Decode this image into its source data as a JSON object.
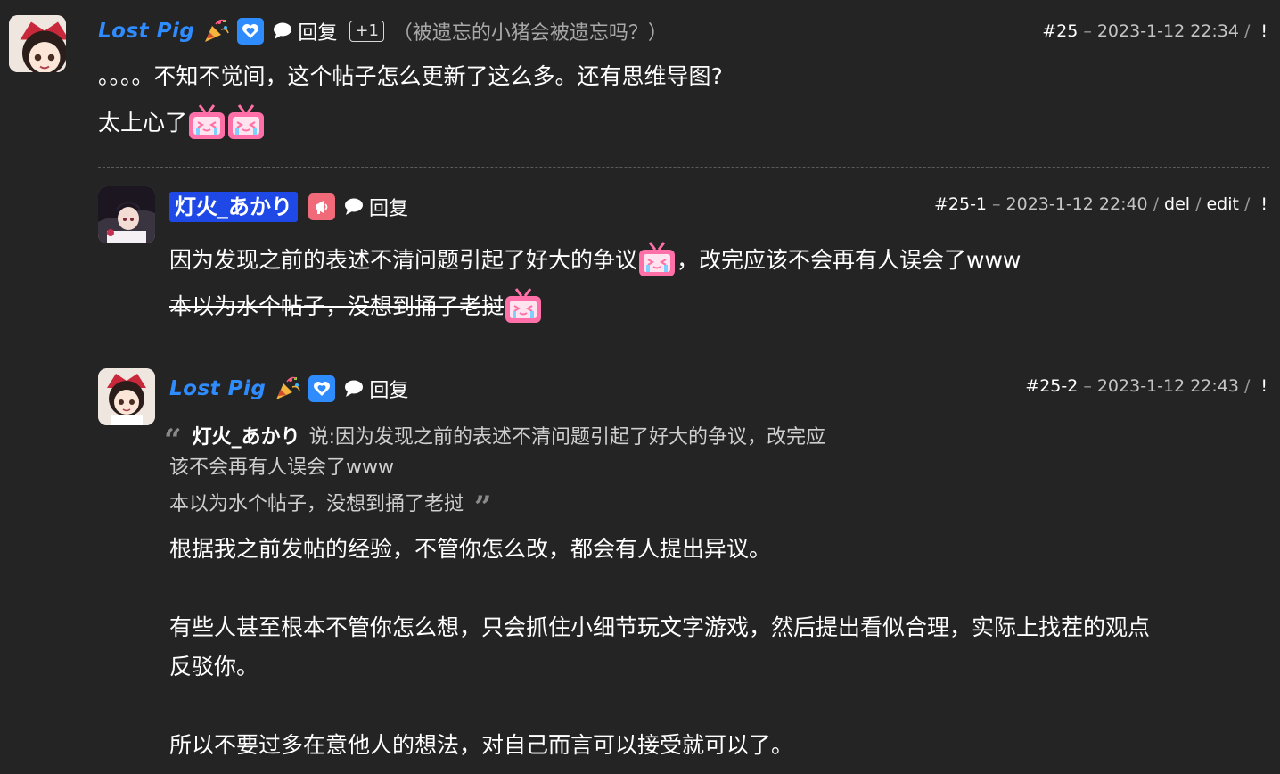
{
  "posts": {
    "p25": {
      "author": "Lost Pig",
      "reply_label": "回复",
      "plus": "+1",
      "thread_title": "（被遗忘的小猪会被遗忘吗？）",
      "num": "#25",
      "dash": "–",
      "date": "2023-1-12 22:34",
      "slash": "/",
      "bang": "!",
      "lines": [
        "。。。。不知不觉间，这个帖子怎么更新了这么多。还有思维导图?",
        "太上心了"
      ]
    },
    "p25_1": {
      "author": "灯火_あかり",
      "reply_label": "回复",
      "num": "#25-1",
      "dash": "–",
      "date": "2023-1-12 22:40",
      "slash": "/",
      "del": "del",
      "edit": "edit",
      "bang": "!",
      "line1a": "因为发现之前的表述不清问题引起了好大的争议",
      "line1b": "，改完应该不会再有人误会了www",
      "line2": "本以为水个帖子，没想到捅了老挝"
    },
    "p25_2": {
      "author": "Lost Pig",
      "reply_label": "回复",
      "num": "#25-2",
      "dash": "–",
      "date": "2023-1-12 22:43",
      "slash": "/",
      "bang": "!",
      "quote": {
        "open": "“",
        "close": "”",
        "name": "灯火_あかり",
        "says": "说: ",
        "line1": "因为发现之前的表述不清问题引起了好大的争议，改完应",
        "line2": "该不会再有人误会了www",
        "line3": "本以为水个帖子，没想到捅了老挝"
      },
      "paragraphs": [
        "根据我之前发帖的经验，不管你怎么改，都会有人提出异议。",
        "有些人甚至根本不管你怎么想，只会抓住小细节玩文字游戏，然后提出看似合理，实际上找茬的观点",
        "反驳你。",
        "所以不要过多在意他人的想法，对自己而言可以接受就可以了。"
      ]
    }
  },
  "colors": {
    "background": "#242424",
    "username_blue": "#2f8cff",
    "highlight_blue": "#1e49e6",
    "badge_pink": "#f06a7a",
    "emoji_pink": "#ff6fa8"
  },
  "icons": {
    "avatar": "anime-girl-avatar",
    "party": "party-popper-icon",
    "heart_badge": "heart-hands-badge-icon",
    "speaker_badge": "megaphone-badge-icon",
    "reply": "speech-bubble-icon",
    "emoji": "bilibili-tv-crying-emoji"
  }
}
